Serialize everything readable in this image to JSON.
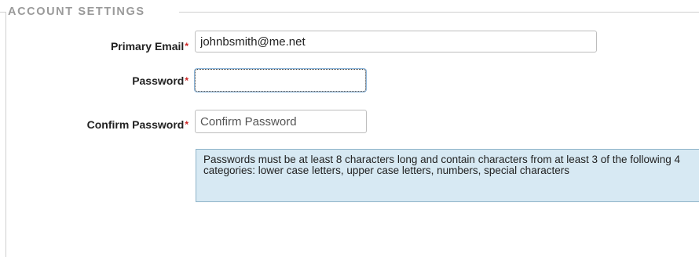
{
  "section": {
    "legend": "ACCOUNT SETTINGS"
  },
  "fields": {
    "email": {
      "label": "Primary Email",
      "required_mark": "*",
      "value": "johnbsmith@me.net"
    },
    "password": {
      "label": "Password",
      "required_mark": "*",
      "value": "",
      "focused": true
    },
    "confirm_password": {
      "label": "Confirm Password",
      "required_mark": "*",
      "value": "",
      "placeholder": "Confirm Password"
    }
  },
  "hint": {
    "text": "Passwords must be at least 8 characters long and contain characters from at least 3 of the following 4 categories: lower case letters, upper case letters, numbers, special characters"
  },
  "colors": {
    "required": "#cc2222",
    "hint_background": "#d7e9f3",
    "hint_border": "#8fb4c9",
    "legend": "#9a9a9a"
  }
}
